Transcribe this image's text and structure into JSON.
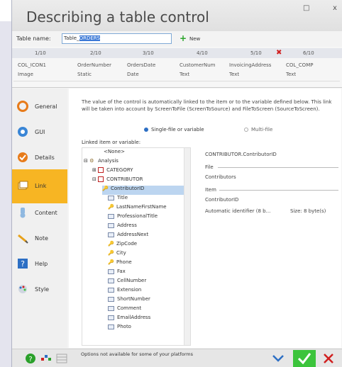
{
  "window": {
    "title": "Describing a table control",
    "restore_glyph": "□",
    "close_glyph": "x"
  },
  "toolbar": {
    "table_name_label": "Table name:",
    "table_name_prefix": "Table_",
    "table_name_selected": "ORDERS",
    "new_label": "New"
  },
  "columns": {
    "numbers": [
      "1/10",
      "2/10",
      "3/10",
      "4/10",
      "5/10",
      "6/10"
    ],
    "names": [
      "COL_ICON1",
      "OrderNumber",
      "OrdersDate",
      "CustomerNum",
      "InvoicingAddress",
      "COL_COMP"
    ],
    "types": [
      "Image",
      "Static",
      "Date",
      "Text",
      "Text",
      "Text"
    ]
  },
  "sidebar": {
    "items": [
      {
        "label": "General",
        "icon": "general-icon"
      },
      {
        "label": "GUI",
        "icon": "gui-icon"
      },
      {
        "label": "Details",
        "icon": "details-icon"
      },
      {
        "label": "Link",
        "icon": "link-icon"
      },
      {
        "label": "Content",
        "icon": "content-icon"
      },
      {
        "label": "Note",
        "icon": "note-icon"
      },
      {
        "label": "Help",
        "icon": "help-icon"
      },
      {
        "label": "Style",
        "icon": "style-icon"
      }
    ],
    "active": "Link"
  },
  "link": {
    "description": "The value of the control is automatically linked to the item or to the variable defined below. This link will be taken into account by ScreenToFile (ScreenToSource) and FileToScreen (SourceToScreen).",
    "radio_single": "Single-file or variable",
    "radio_multi": "Multi-file",
    "linked_label": "Linked item or variable:",
    "tree": [
      "<None>",
      "Analysis",
      "CATEGORY",
      "CONTRIBUTOR",
      "ContributorID",
      "Title",
      "LastNameFirstName",
      "ProfessionalTitle",
      "Address",
      "AddressNext",
      "ZipCode",
      "City",
      "Phone",
      "Fax",
      "CellNumber",
      "Extension",
      "ShortNumber",
      "Comment",
      "EmailAddress",
      "Photo"
    ],
    "selected": "ContributorID",
    "details": {
      "path": "CONTRIBUTOR.ContributorID",
      "file_label": "File",
      "file_value": "Contributors",
      "item_label": "Item",
      "item_value": "ContributorID",
      "item_type": "Automatic identifier (8 b...",
      "item_size": "Size: 8 byte(s)"
    }
  },
  "footer": {
    "note": "Options not available for some of your platforms"
  },
  "colors": {
    "accent": "#f7b523",
    "ok": "#3cc43c",
    "cancel": "#d02020",
    "selection": "#3a78d6"
  }
}
